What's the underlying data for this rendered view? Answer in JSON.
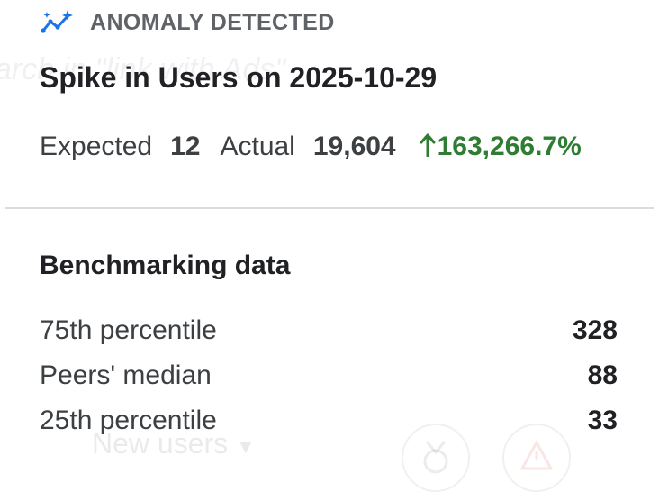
{
  "header": {
    "icon": "sparkle-trend-icon",
    "label": "ANOMALY DETECTED",
    "icon_color": "#1a73e8"
  },
  "title": "Spike in Users on 2025-10-29",
  "stats": {
    "expected_label": "Expected",
    "expected_value": "12",
    "actual_label": "Actual",
    "actual_value": "19,604",
    "delta_icon": "arrow-up-icon",
    "delta_value": "163,266.7%",
    "delta_color": "#2e7d32"
  },
  "benchmark": {
    "title": "Benchmarking data",
    "rows": [
      {
        "label": "75th percentile",
        "value": "328"
      },
      {
        "label": "Peers' median",
        "value": "88"
      },
      {
        "label": "25th percentile",
        "value": "33"
      }
    ]
  },
  "background": {
    "search_hint": "arch in \"link with Ads\"",
    "dropdown_label": "New users"
  }
}
